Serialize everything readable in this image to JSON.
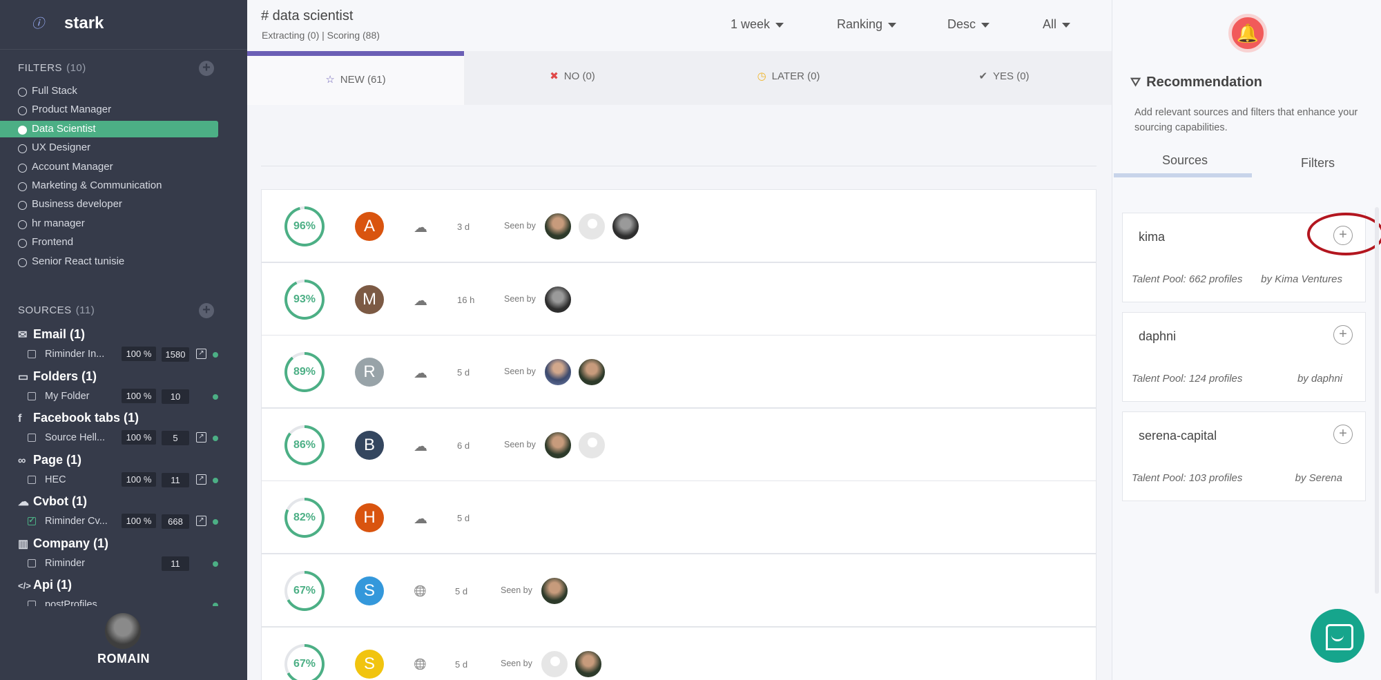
{
  "brand": {
    "name": "stark"
  },
  "filters": {
    "title": "FILTERS",
    "count": "(10)",
    "items": [
      "Full Stack",
      "Product Manager",
      "Data Scientist",
      "UX Designer",
      "Account Manager",
      "Marketing & Communication",
      "Business developer",
      "hr manager",
      "Frontend",
      "Senior React tunisie"
    ],
    "active_index": 2
  },
  "sources": {
    "title": "SOURCES",
    "count": "(11)",
    "groups": [
      {
        "label": "Email (1)",
        "icon": "envelope-icon",
        "row": {
          "name": "Riminder In...",
          "pct": "100 %",
          "num": "1580",
          "ext": true,
          "checked": false
        }
      },
      {
        "label": "Folders (1)",
        "icon": "folder-icon",
        "row": {
          "name": "My Folder",
          "pct": "100 %",
          "num": "10",
          "ext": false,
          "checked": false
        }
      },
      {
        "label": "Facebook tabs (1)",
        "icon": "facebook-icon",
        "row": {
          "name": "Source Hell...",
          "pct": "100 %",
          "num": "5",
          "ext": true,
          "checked": false
        }
      },
      {
        "label": "Page (1)",
        "icon": "link-icon",
        "row": {
          "name": "HEC",
          "pct": "100 %",
          "num": "11",
          "ext": true,
          "checked": false
        }
      },
      {
        "label": "Cvbot (1)",
        "icon": "cloud-upload-icon",
        "row": {
          "name": "Riminder Cv...",
          "pct": "100 %",
          "num": "668",
          "ext": true,
          "checked": true
        }
      },
      {
        "label": "Company (1)",
        "icon": "building-icon",
        "row": {
          "name": "Riminder",
          "pct": "",
          "num": "11",
          "ext": false,
          "checked": false
        }
      },
      {
        "label": "Api (1)",
        "icon": "code-icon",
        "row": {
          "name": "postProfiles",
          "pct": "",
          "num": "",
          "ext": false,
          "checked": false
        }
      }
    ]
  },
  "user": {
    "name": "ROMAIN"
  },
  "header": {
    "title": "# data scientist",
    "subtitle": "Extracting (0)  |  Scoring (88)",
    "dropdowns": [
      "1 week",
      "Ranking",
      "Desc",
      "All"
    ]
  },
  "tabs": [
    {
      "label": "NEW (61)",
      "icon": "☆",
      "color": "#6b5fb5"
    },
    {
      "label": "NO (0)",
      "icon": "✖",
      "color": "#e04848"
    },
    {
      "label": "LATER (0)",
      "icon": "◷",
      "color": "#f0b429"
    },
    {
      "label": "YES (0)",
      "icon": "✔",
      "color": "#555555"
    }
  ],
  "candidates": [
    {
      "score": "96%",
      "score_value": 96,
      "letter": "A",
      "color": "#d9540f",
      "source_icon": "cloud-upload-icon",
      "age": "3 d",
      "seen_label": "Seen by",
      "viewers": [
        "dark",
        "blank",
        "bw"
      ]
    },
    {
      "score": "93%",
      "score_value": 93,
      "letter": "M",
      "color": "#7c5a44",
      "source_icon": "cloud-upload-icon",
      "age": "16 h",
      "seen_label": "Seen by",
      "viewers": [
        "bw"
      ]
    },
    {
      "score": "89%",
      "score_value": 89,
      "letter": "R",
      "color": "#98a3a8",
      "source_icon": "cloud-upload-icon",
      "age": "5 d",
      "seen_label": "Seen by",
      "viewers": [
        "suit",
        "dark"
      ]
    },
    {
      "score": "86%",
      "score_value": 86,
      "letter": "B",
      "color": "#34465f",
      "source_icon": "cloud-upload-icon",
      "age": "6 d",
      "seen_label": "Seen by",
      "viewers": [
        "dark",
        "blank"
      ]
    },
    {
      "score": "82%",
      "score_value": 82,
      "letter": "H",
      "color": "#d9540f",
      "source_icon": "cloud-upload-icon",
      "age": "5 d",
      "seen_label": "",
      "viewers": []
    },
    {
      "score": "67%",
      "score_value": 67,
      "letter": "S",
      "color": "#3498db",
      "source_icon": "globe-icon",
      "age": "5 d",
      "seen_label": "Seen by",
      "viewers": [
        "dark"
      ]
    },
    {
      "score": "67%",
      "score_value": 67,
      "letter": "S",
      "color": "#f1c40f",
      "source_icon": "globe-icon",
      "age": "5 d",
      "seen_label": "Seen by",
      "viewers": [
        "blank",
        "dark"
      ]
    }
  ],
  "recommendation": {
    "title": "Recommendation",
    "description": "Add relevant sources and filters that enhance your sourcing capabilities.",
    "tabs": [
      "Sources",
      "Filters"
    ],
    "cards": [
      {
        "name": "kima",
        "pool": "Talent Pool: 662 profiles",
        "by": "by Kima Ventures"
      },
      {
        "name": "daphni",
        "pool": "Talent Pool: 124 profiles",
        "by": "by daphni"
      },
      {
        "name": "serena-capital",
        "pool": "Talent Pool: 103 profiles",
        "by": "by Serena"
      }
    ]
  }
}
